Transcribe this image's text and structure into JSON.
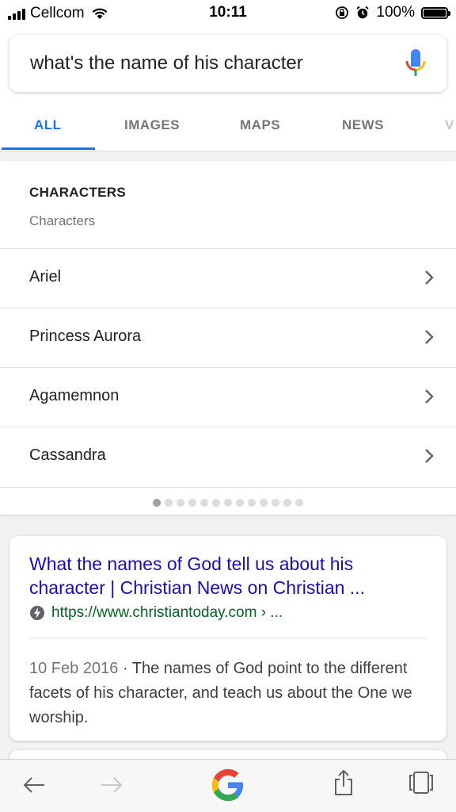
{
  "status_bar": {
    "carrier": "Cellcom",
    "time": "10:11",
    "battery_percent": "100%",
    "battery_level": 1.0
  },
  "search": {
    "query": "what's the name of his character",
    "mic_icon": "microphone-icon"
  },
  "tabs": [
    {
      "label": "ALL",
      "active": true
    },
    {
      "label": "IMAGES",
      "active": false
    },
    {
      "label": "MAPS",
      "active": false
    },
    {
      "label": "NEWS",
      "active": false
    },
    {
      "label": "V",
      "active": false
    }
  ],
  "characters_card": {
    "title": "CHARACTERS",
    "subtitle": "Characters",
    "items": [
      {
        "name": "Ariel"
      },
      {
        "name": "Princess Aurora"
      },
      {
        "name": "Agamemnon"
      },
      {
        "name": "Cassandra"
      }
    ],
    "page_count": 13,
    "current_page": 1
  },
  "result": {
    "title": "What the names of God tell us about his character | Christian News on Christian ...",
    "url": "https://www.christiantoday.com › ...",
    "amp_icon": "lightning-bolt-icon",
    "date": "10 Feb 2016",
    "snippet": "The names of God point to the different facets of his character, and teach us about the One we worship."
  },
  "toolbar": {
    "icons": [
      "back-arrow-icon",
      "forward-arrow-icon",
      "google-logo-icon",
      "share-icon",
      "tabs-icon"
    ]
  },
  "colors": {
    "accent_blue": "#1a73e8",
    "link_blue": "#1a0dab",
    "url_green": "#006621"
  }
}
